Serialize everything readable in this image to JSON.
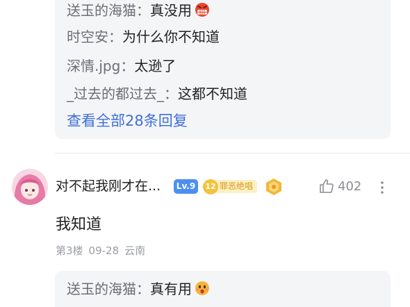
{
  "replies_top": [
    {
      "author": "送玉的海猫",
      "sep": "：",
      "text": "真没用",
      "emoji": "angry-face-emoji"
    },
    {
      "author": "时空安",
      "sep": "：",
      "text": "为什么你不知道"
    },
    {
      "author": "深情.jpg",
      "sep": "：",
      "text": "太逊了"
    },
    {
      "author": "_过去的都过去_",
      "sep": "：",
      "text": "这都不知道"
    }
  ],
  "view_all_label": "查看全部28条回复",
  "comment": {
    "username": "对不起我刚才在...",
    "level": "Lv.9",
    "fan_level": "12",
    "fan_name": "罪恶绝唱",
    "likes": "402",
    "text": "我知道",
    "floor": "第3楼",
    "date": "09-28",
    "location": "云南"
  },
  "replies_bottom": [
    {
      "author": "送玉的海猫",
      "sep": "：",
      "text": "真有用",
      "emoji": "surprised-face-emoji"
    }
  ],
  "colors": {
    "link": "#3f6fd8",
    "reply_bg": "#f4f5f7",
    "level_badge": "#4c8ff0",
    "fan_badge": "#f3c33d"
  }
}
